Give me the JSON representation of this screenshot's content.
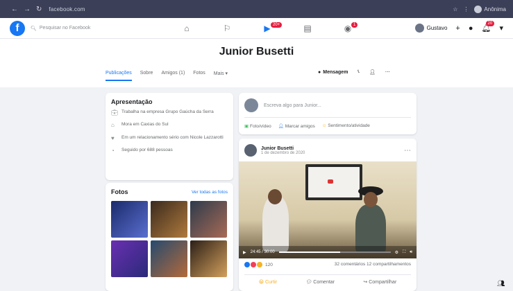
{
  "browser": {
    "url": "facebook.com",
    "profile_label": "Anônima"
  },
  "topbar": {
    "search_placeholder": "Pesquisar no Facebook",
    "notif_badge": "20+",
    "watch_badge": "1",
    "account_name": "Gustavo",
    "account_badge": "20"
  },
  "profile": {
    "name": "Junior Busetti",
    "tabs": [
      "Publicações",
      "Sobre",
      "Amigos (1)",
      "Fotos",
      "Mais ▾"
    ],
    "message_label": "Mensagem"
  },
  "intro": {
    "title": "Apresentação",
    "items": [
      {
        "icon": "briefcase-icon",
        "text": "Trabalha na empresa Grupo Gaúcha da Serra"
      },
      {
        "icon": "home-icon",
        "text": "Mora em Caxias do Sul"
      },
      {
        "icon": "heart-icon",
        "text": "Em um relacionamento sério com Nicole Lazzarotti"
      },
      {
        "icon": "rss-icon",
        "text": "Seguido por 688 pessoas"
      }
    ]
  },
  "photos": {
    "title": "Fotos",
    "see_all": "Ver todas as fotos"
  },
  "composer": {
    "placeholder": "Escreva algo para Junior...",
    "buttons": [
      "Foto/vídeo",
      "Marcar amigos",
      "Sentimento/atividade"
    ]
  },
  "post": {
    "author": "Junior Busetti",
    "subline": "1 de dezembro de 2020",
    "video_time": "24:45 / 30:00",
    "progress": 0.55,
    "reactions_count": "120",
    "comments_shares": "32 comentários 12 compartilhamentos",
    "actions": [
      "Curtir",
      "Comentar",
      "Compartilhar"
    ]
  },
  "colors": {
    "brand": "#1877f2",
    "badge": "#e41e3f"
  }
}
